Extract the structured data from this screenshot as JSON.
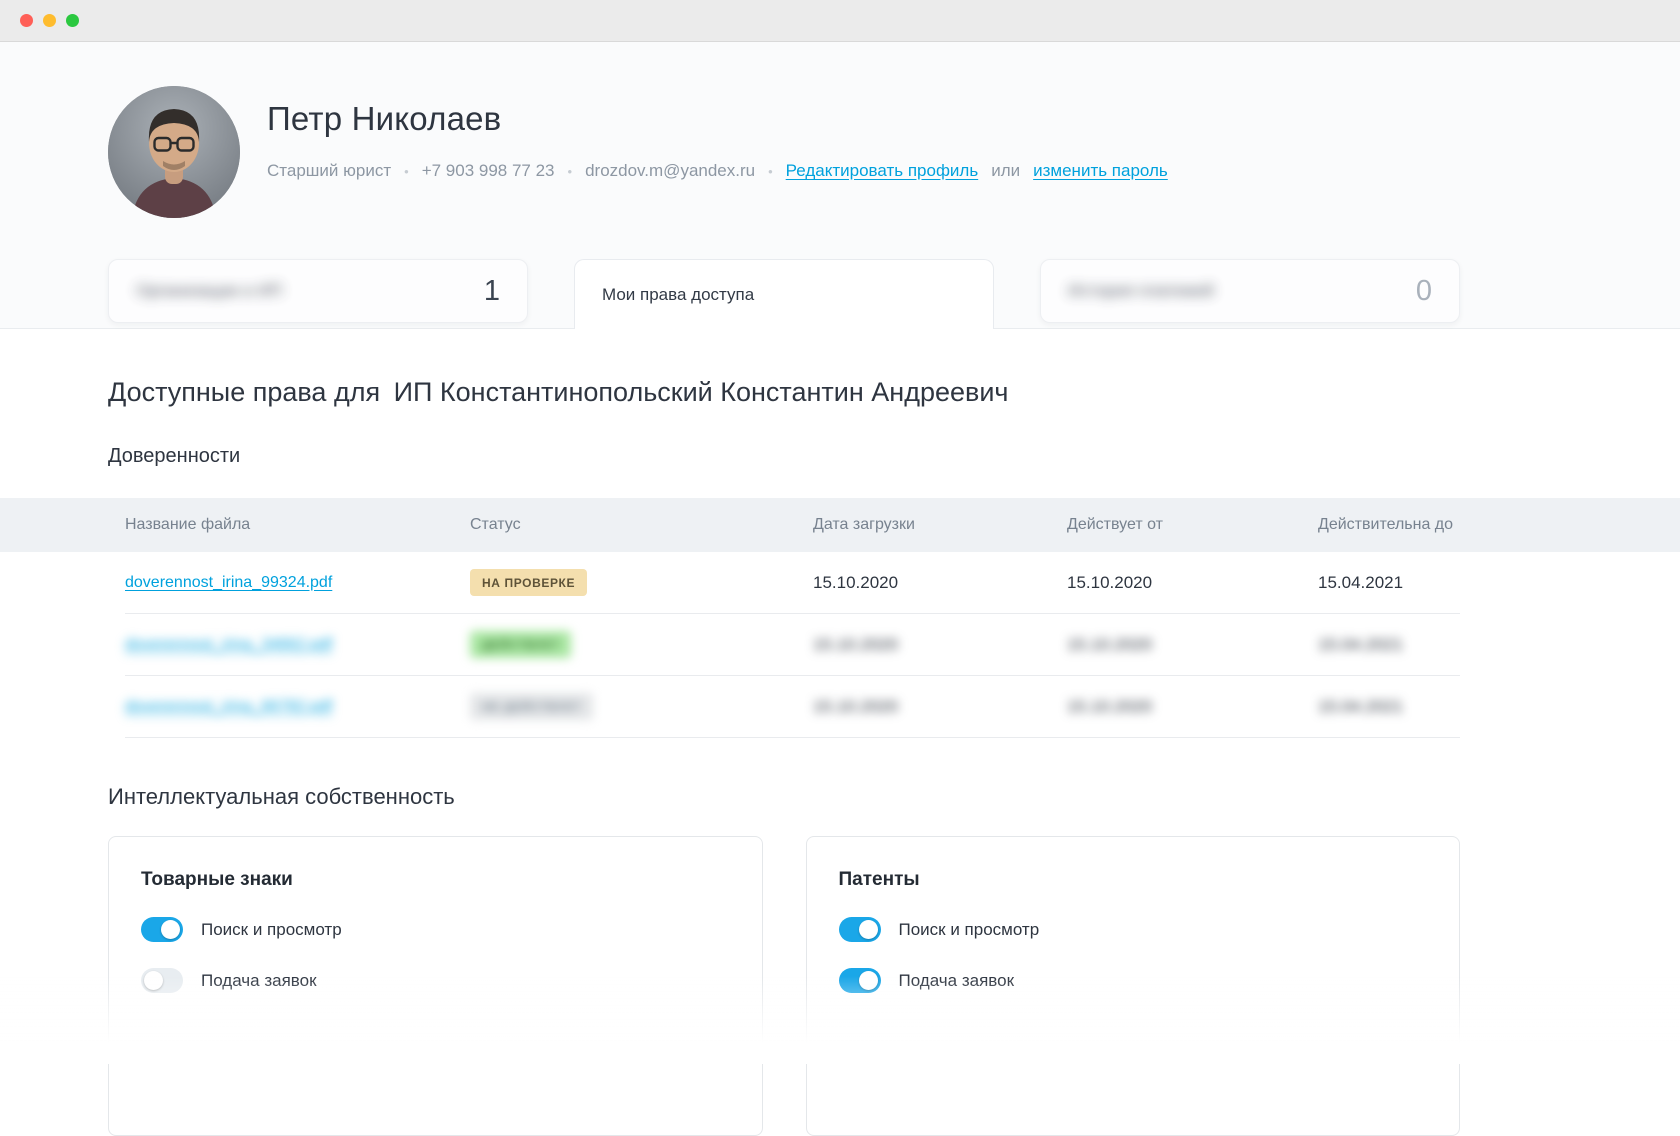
{
  "colors": {
    "accent_blue": "#00a1dd",
    "toggle_on": "#1aa7e8",
    "badge_pending_bg": "#f4dfae",
    "badge_active_bg": "#a9e7a2",
    "badge_inactive_bg": "#e4e6e8",
    "table_header_bg": "#eef1f4"
  },
  "profile": {
    "name": "Петр Николаев",
    "role": "Старший юрист",
    "phone": "+7 903 998 77 23",
    "email": "drozdov.m@yandex.ru",
    "separator": "•",
    "edit_profile_link": "Редактировать профиль",
    "or_text": "или",
    "change_password_link": "изменить пароль"
  },
  "tabs": {
    "items": [
      {
        "label": "Организации и ИП",
        "count": "1",
        "blurred": true,
        "active": false
      },
      {
        "label": "Мои права доступа",
        "count": "",
        "blurred": false,
        "active": true
      },
      {
        "label": "История платежей",
        "count": "0",
        "blurred": true,
        "active": false
      }
    ]
  },
  "access": {
    "title_prefix": "Доступные права для",
    "title_entity": "ИП Константинопольский Константин Андреевич",
    "section_poa": "Доверенности"
  },
  "poa_table": {
    "headers": [
      "Название файла",
      "Статус",
      "Дата загрузки",
      "Действует от",
      "Действительна до"
    ],
    "rows": [
      {
        "filename": "doverennost_irina_99324.pdf",
        "status": "НА ПРОВЕРКЕ",
        "status_type": "pending",
        "uploaded": "15.10.2020",
        "valid_from": "15.10.2020",
        "valid_to": "15.04.2021",
        "blurred": false
      },
      {
        "filename": "doverennost_irina_34662.pdf",
        "status": "ДЕЙСТВУЕТ",
        "status_type": "active",
        "uploaded": "15.10.2020",
        "valid_from": "15.10.2020",
        "valid_to": "15.04.2021",
        "blurred": true
      },
      {
        "filename": "doverennost_irina_66782.pdf",
        "status": "НЕ ДЕЙСТВУЕТ",
        "status_type": "inactive",
        "uploaded": "15.10.2020",
        "valid_from": "15.10.2020",
        "valid_to": "15.04.2021",
        "blurred": true
      }
    ]
  },
  "ip_section": {
    "title": "Интеллектуальная собственность",
    "cards": [
      {
        "title": "Товарные знаки",
        "toggles": [
          {
            "label": "Поиск и просмотр",
            "on": true
          },
          {
            "label": "Подача заявок",
            "on": false
          }
        ]
      },
      {
        "title": "Патенты",
        "toggles": [
          {
            "label": "Поиск и просмотр",
            "on": true
          },
          {
            "label": "Подача заявок",
            "on": true
          }
        ]
      }
    ]
  }
}
